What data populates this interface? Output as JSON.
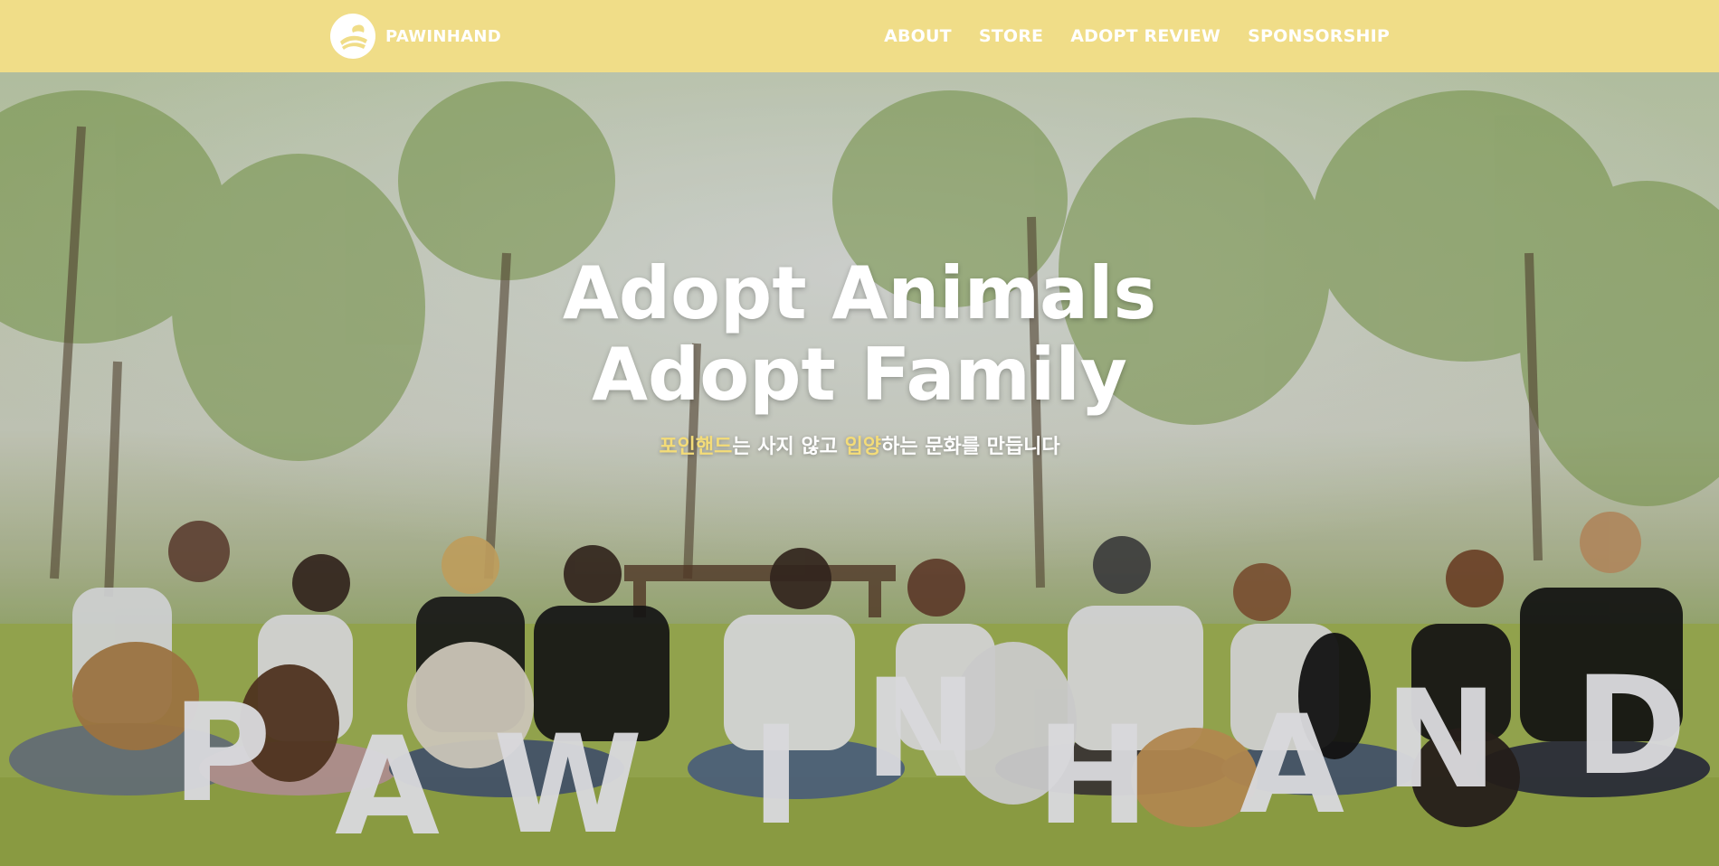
{
  "brand": {
    "name": "PAWINHAND",
    "icon": "paw-in-hand-logo-icon"
  },
  "nav": {
    "items": [
      {
        "label": "ABOUT"
      },
      {
        "label": "STORE"
      },
      {
        "label": "ADOPT REVIEW"
      },
      {
        "label": "SPONSORSHIP"
      }
    ]
  },
  "hero": {
    "title_line1": "Adopt Animals",
    "title_line2": "Adopt Family",
    "subtitle": {
      "part1": "포인핸드",
      "part2": "는 사지 않고 ",
      "part3": "입양",
      "part4": "하는 문화를 만듭니다"
    },
    "photo_banner_letters": [
      "P",
      "A",
      "W",
      "I",
      "N",
      "H",
      "A",
      "N",
      "D"
    ]
  },
  "colors": {
    "header_bg": "#f0dd88",
    "highlight": "#f4dc78",
    "text": "#ffffff"
  }
}
